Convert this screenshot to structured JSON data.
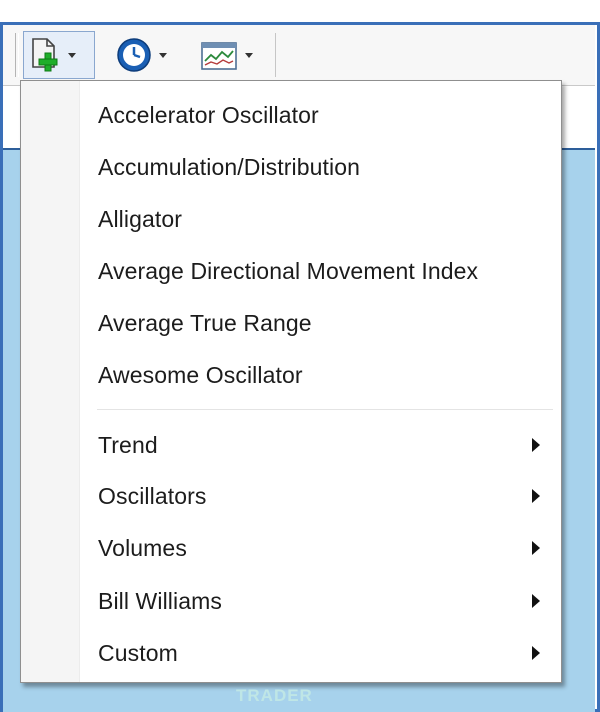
{
  "toolbar": {
    "buttons": [
      {
        "name": "new-indicator-button",
        "icon": "new-document-plus-icon"
      },
      {
        "name": "periodicity-button",
        "icon": "clock-icon"
      },
      {
        "name": "templates-button",
        "icon": "chart-template-icon"
      }
    ]
  },
  "menu": {
    "indicators": [
      "Accelerator Oscillator",
      "Accumulation/Distribution",
      "Alligator",
      "Average Directional Movement Index",
      "Average True Range",
      "Awesome Oscillator"
    ],
    "submenus": [
      "Trend",
      "Oscillators",
      "Volumes",
      "Bill Williams",
      "Custom"
    ]
  },
  "watermark": {
    "text": "TRADER"
  },
  "colors": {
    "window_border": "#3a6fb8",
    "chart_background": "#a7d2ec",
    "menu_background": "#ffffff",
    "menu_gutter": "#f5f5f5",
    "text": "#1c1c1c",
    "watermark": "#bfe6e6"
  }
}
